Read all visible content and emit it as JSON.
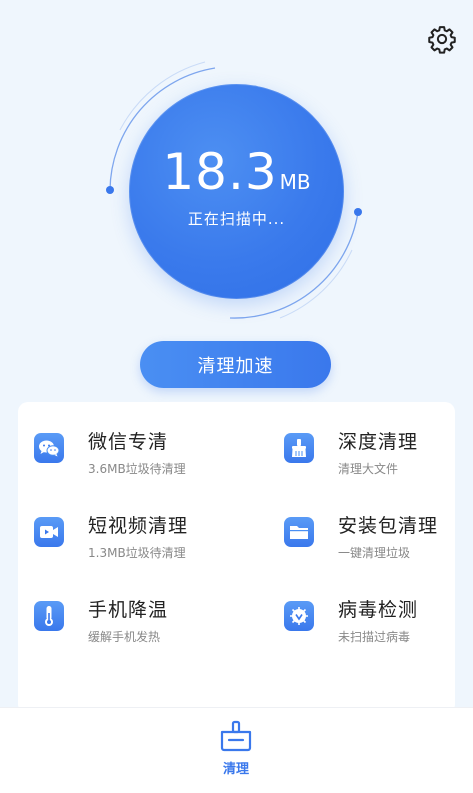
{
  "scan": {
    "size_value": "18.3",
    "size_unit": "MB",
    "status": "正在扫描中..."
  },
  "accelerate_label": "清理加速",
  "features": [
    {
      "title": "微信专清",
      "subtitle": "3.6MB垃圾待清理",
      "icon": "wechat-icon"
    },
    {
      "title": "深度清理",
      "subtitle": "清理大文件",
      "icon": "broom-icon"
    },
    {
      "title": "短视频清理",
      "subtitle": "1.3MB垃圾待清理",
      "icon": "video-icon"
    },
    {
      "title": "安装包清理",
      "subtitle": "一键清理垃圾",
      "icon": "folder-icon"
    },
    {
      "title": "手机降温",
      "subtitle": "缓解手机发热",
      "icon": "thermometer-icon"
    },
    {
      "title": "病毒检测",
      "subtitle": "未扫描过病毒",
      "icon": "shield-icon"
    }
  ],
  "nav": {
    "tab_label": "清理"
  },
  "colors": {
    "accent": "#3a78ec",
    "background": "#eff6fd"
  }
}
